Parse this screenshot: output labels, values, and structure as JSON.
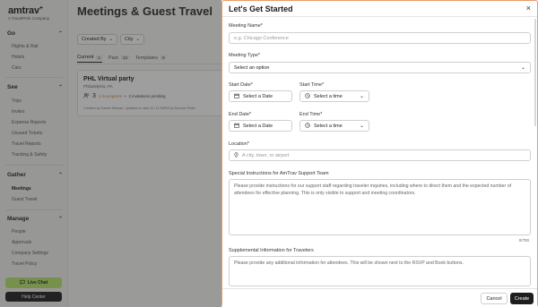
{
  "sidebar": {
    "brand": "amtrav",
    "brand_mark": "+",
    "tagline": "A TravelPerk Company",
    "sections": [
      {
        "title": "Go",
        "items": [
          "Flights & Rail",
          "Hotels",
          "Cars"
        ]
      },
      {
        "title": "See",
        "items": [
          "Trips",
          "Invites",
          "Expense Reports",
          "Unused Tickets",
          "Travel Reports",
          "Tracking & Safety"
        ]
      },
      {
        "title": "Gather",
        "items": [
          "Meetings",
          "Guest Travel"
        ]
      },
      {
        "title": "Manage",
        "items": [
          "People",
          "Approvals",
          "Company Settings",
          "Travel Policy"
        ]
      }
    ],
    "live_chat": "Live Chat",
    "help_center": "Help Center"
  },
  "main": {
    "title": "Meetings & Guest Travel",
    "filters": [
      "Created By",
      "City"
    ],
    "tabs": [
      {
        "label": "Current",
        "count": "1"
      },
      {
        "label": "Past",
        "count": "13"
      },
      {
        "label": "Templates",
        "count": "0"
      }
    ],
    "card": {
      "title": "PHL Virtual party",
      "location": "Philadelphia, PA",
      "count": "3",
      "status": "1 in progress",
      "sep": " • ",
      "pending": "2 invitations pending",
      "meta": "Created by Gaven Winsan, updated on Mar 20, 11:30PM by Rounce Peter"
    }
  },
  "drawer": {
    "title": "Let's Get Started",
    "close": "×",
    "meeting_name_label": "Meeting Name*",
    "meeting_name_placeholder": "e.g. Chicago Conference",
    "meeting_type_label": "Meeting Type*",
    "meeting_type_value": "Select an option",
    "start_date_label": "Start Date*",
    "start_date_value": "Select a Date",
    "start_time_label": "Start Time*",
    "start_time_value": "Select a time",
    "end_date_label": "End Date*",
    "end_date_value": "Select a Date",
    "end_time_label": "End Time*",
    "end_time_value": "Select a time",
    "location_label": "Location*",
    "location_placeholder": "A city, town, or airport",
    "special_label": "Special Instructions for AmTrav Support Team",
    "special_placeholder": "Please provide instructions for our support staff regarding traveler inquiries, including where to direct them and the expected number of attendees for effective planning. This is only visible to support and meeting coordinators.",
    "special_counter": "0/700",
    "supplemental_label": "Supplemental Information for Travelers",
    "supplemental_placeholder": "Please provide any additional information for attendees. This will be shown next to the RSVP and Book buttons.",
    "cancel": "Cancel",
    "create": "Create"
  },
  "icons": {
    "chevron_up": "⌃",
    "chevron_down": "⌄",
    "calendar": "calendar-icon",
    "clock": "clock-icon",
    "location": "location-pin-icon"
  },
  "colors": {
    "accent_green": "#b7e76a",
    "drawer_border": "#e89a6d",
    "progress": "#c0892a",
    "dark_button": "#1e1e1e"
  }
}
